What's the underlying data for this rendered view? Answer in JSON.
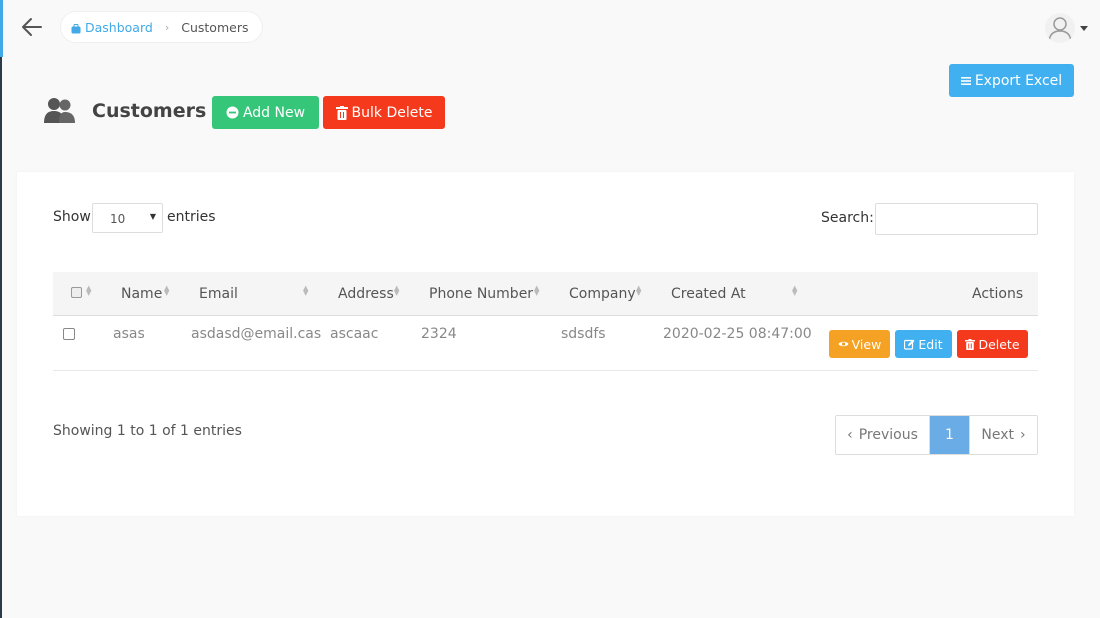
{
  "breadcrumb": {
    "home": "Dashboard",
    "current": "Customers"
  },
  "header": {
    "title": "Customers",
    "add_new": "Add New",
    "bulk_delete": "Bulk Delete",
    "export_excel": "Export Excel"
  },
  "controls": {
    "show": "Show",
    "entries_value": "10",
    "entries": "entries",
    "search": "Search:"
  },
  "table": {
    "columns": [
      "Name",
      "Email",
      "Address",
      "Phone Number",
      "Company",
      "Created At",
      "Actions"
    ],
    "rows": [
      {
        "name": "asas",
        "email": "asdasd@email.cas",
        "address": "ascaac",
        "phone": "2324",
        "company": "sdsdfs",
        "created_at": "2020-02-25 08:47:00"
      }
    ],
    "actions": {
      "view": "View",
      "edit": "Edit",
      "delete": "Delete"
    }
  },
  "footer": {
    "showing": "Showing 1 to 1 of 1 entries",
    "previous": "Previous",
    "page": "1",
    "next": "Next"
  },
  "colors": {
    "accent": "#41a9e8",
    "add": "#35c67a",
    "delete": "#f5391c",
    "view": "#f4a124",
    "edit": "#41b0f0",
    "active_page": "#6aace6"
  }
}
